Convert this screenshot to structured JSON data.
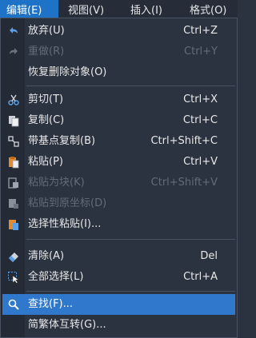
{
  "menubar": {
    "items": [
      {
        "label": "编辑(E)",
        "active": true
      },
      {
        "label": "视图(V)",
        "active": false
      },
      {
        "label": "插入(I)",
        "active": false
      },
      {
        "label": "格式(O)",
        "active": false
      }
    ]
  },
  "menu": {
    "items": [
      {
        "label": "放弃(U)",
        "shortcut": "Ctrl+Z",
        "icon": "undo-icon",
        "disabled": false
      },
      {
        "label": "重做(R)",
        "shortcut": "Ctrl+Y",
        "icon": "redo-icon",
        "disabled": true
      },
      {
        "label": "恢复删除对象(O)",
        "shortcut": "",
        "icon": "",
        "disabled": false
      },
      {
        "label": "剪切(T)",
        "shortcut": "Ctrl+X",
        "icon": "scissors-icon",
        "disabled": false
      },
      {
        "label": "复制(C)",
        "shortcut": "Ctrl+C",
        "icon": "copy-icon",
        "disabled": false
      },
      {
        "label": "带基点复制(B)",
        "shortcut": "Ctrl+Shift+C",
        "icon": "copy-with-basepoint-icon",
        "disabled": false
      },
      {
        "label": "粘贴(P)",
        "shortcut": "Ctrl+V",
        "icon": "paste-icon",
        "disabled": false
      },
      {
        "label": "粘贴为块(K)",
        "shortcut": "Ctrl+Shift+V",
        "icon": "paste-as-block-icon",
        "disabled": true
      },
      {
        "label": "粘贴到原坐标(D)",
        "shortcut": "",
        "icon": "paste-original-coords-icon",
        "disabled": true
      },
      {
        "label": "选择性粘贴(I)...",
        "shortcut": "",
        "icon": "paste-special-icon",
        "disabled": false
      },
      {
        "label": "清除(A)",
        "shortcut": "Del",
        "icon": "eraser-icon",
        "disabled": false
      },
      {
        "label": "全部选择(L)",
        "shortcut": "Ctrl+A",
        "icon": "select-all-icon",
        "disabled": false
      },
      {
        "label": "查找(F)...",
        "shortcut": "",
        "icon": "find-icon",
        "disabled": false,
        "highlighted": true
      },
      {
        "label": "简繁体互转(G)...",
        "shortcut": "",
        "icon": "",
        "disabled": false
      }
    ]
  },
  "colors": {
    "background": "#2b3240",
    "gutter": "#252b36",
    "highlight": "#2f78cc",
    "menubar_active": "#1e73c7",
    "text": "#e8e8e8",
    "disabled_text": "#646b78"
  }
}
